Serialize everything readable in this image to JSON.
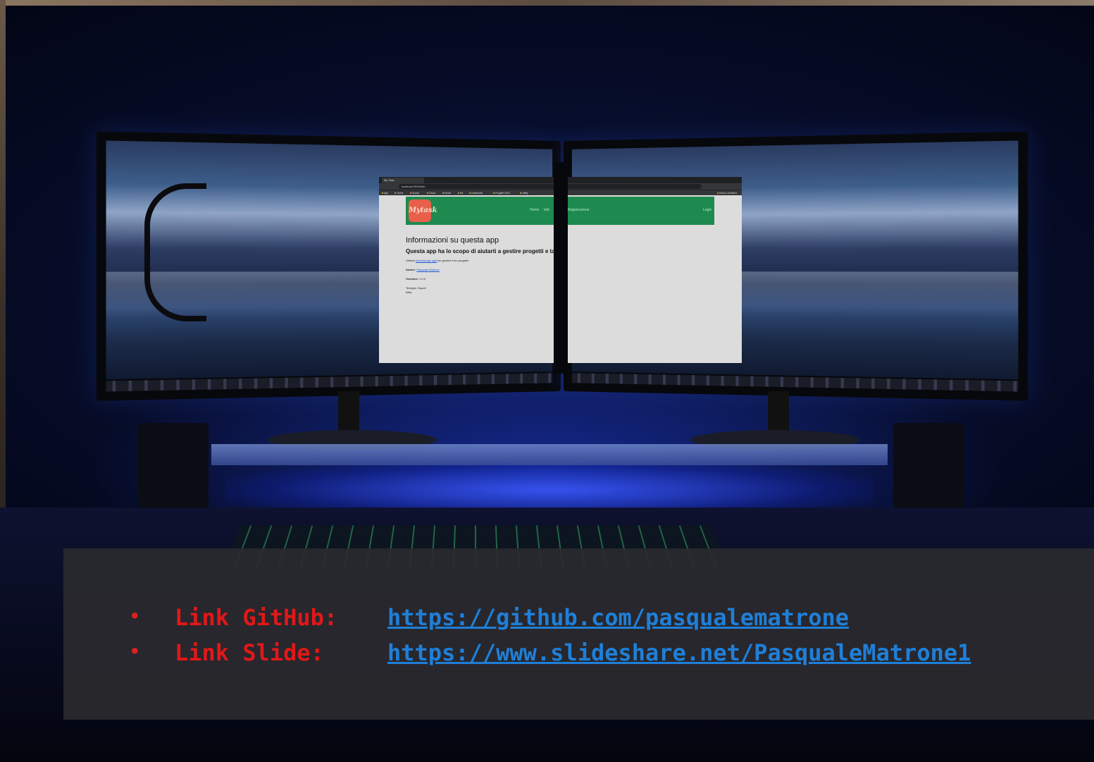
{
  "browser": {
    "tab_title": "My Task",
    "url": "localhost:3000/info",
    "bookmarks": [
      "App",
      "Home",
      "Social",
      "Cloud",
      "Email",
      "PA",
      "Università",
      "Progetti 2021",
      "Utility"
    ],
    "bookmarks_right": "Elenco di lettura"
  },
  "page": {
    "logo_text": "Mytask",
    "nav": {
      "home": "Home",
      "info": "Info",
      "registrazione": "Registrazione",
      "login": "Login"
    },
    "heading": "Informazioni su questa app",
    "subheading": "Questa app ha lo scopo di aiutarti a gestire progetti e task",
    "line1_prefix": "Utilizza ",
    "line1_link": "metodologie agili",
    "line1_suffix": " per gestire il tuo progetto",
    "author_label": "Autore:",
    "author_value": "Pasquale Matrone",
    "version_label": "Versione:",
    "version_value": "1.0.0",
    "address_line1": "Terzigno, Napoli",
    "address_line2": "Italia"
  },
  "links": [
    {
      "bullet": "•",
      "label": "Link GitHub:",
      "url": "https://github.com/pasqualematrone"
    },
    {
      "bullet": "•",
      "label": "Link Slide:",
      "url": "https://www.slideshare.net/PasqualeMatrone1"
    }
  ],
  "colors": {
    "label": "#e01818",
    "link": "#1f7fd8",
    "navbar": "#1e8a4f",
    "logo": "#e8604a",
    "overlay": "#2a2a2e"
  }
}
